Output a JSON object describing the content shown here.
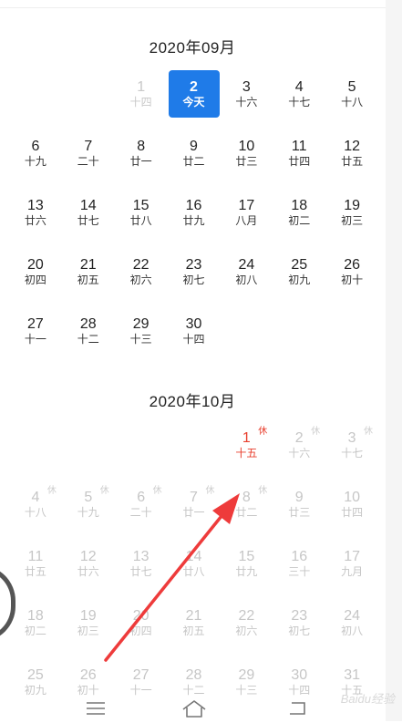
{
  "months": [
    {
      "title": "2020年09月",
      "cells": [
        {
          "blank": true
        },
        {
          "blank": true
        },
        {
          "num": "1",
          "lunar": "十四",
          "state": "prev"
        },
        {
          "num": "2",
          "lunar": "今天",
          "state": "today"
        },
        {
          "num": "3",
          "lunar": "十六"
        },
        {
          "num": "4",
          "lunar": "十七"
        },
        {
          "num": "5",
          "lunar": "十八"
        },
        {
          "num": "6",
          "lunar": "十九"
        },
        {
          "num": "7",
          "lunar": "二十"
        },
        {
          "num": "8",
          "lunar": "廿一"
        },
        {
          "num": "9",
          "lunar": "廿二"
        },
        {
          "num": "10",
          "lunar": "廿三"
        },
        {
          "num": "11",
          "lunar": "廿四"
        },
        {
          "num": "12",
          "lunar": "廿五"
        },
        {
          "num": "13",
          "lunar": "廿六"
        },
        {
          "num": "14",
          "lunar": "廿七"
        },
        {
          "num": "15",
          "lunar": "廿八"
        },
        {
          "num": "16",
          "lunar": "廿九"
        },
        {
          "num": "17",
          "lunar": "八月"
        },
        {
          "num": "18",
          "lunar": "初二"
        },
        {
          "num": "19",
          "lunar": "初三"
        },
        {
          "num": "20",
          "lunar": "初四"
        },
        {
          "num": "21",
          "lunar": "初五"
        },
        {
          "num": "22",
          "lunar": "初六"
        },
        {
          "num": "23",
          "lunar": "初七"
        },
        {
          "num": "24",
          "lunar": "初八"
        },
        {
          "num": "25",
          "lunar": "初九"
        },
        {
          "num": "26",
          "lunar": "初十"
        },
        {
          "num": "27",
          "lunar": "十一"
        },
        {
          "num": "28",
          "lunar": "十二"
        },
        {
          "num": "29",
          "lunar": "十三"
        },
        {
          "num": "30",
          "lunar": "十四"
        }
      ]
    },
    {
      "title": "2020年10月",
      "cells": [
        {
          "blank": true
        },
        {
          "blank": true
        },
        {
          "blank": true
        },
        {
          "blank": true
        },
        {
          "num": "1",
          "lunar": "十五",
          "state": "red",
          "badge": "休"
        },
        {
          "num": "2",
          "lunar": "十六",
          "state": "faded",
          "badge": "休"
        },
        {
          "num": "3",
          "lunar": "十七",
          "state": "faded",
          "badge": "休"
        },
        {
          "num": "4",
          "lunar": "十八",
          "state": "faded",
          "badge": "休"
        },
        {
          "num": "5",
          "lunar": "十九",
          "state": "faded",
          "badge": "休"
        },
        {
          "num": "6",
          "lunar": "二十",
          "state": "faded",
          "badge": "休"
        },
        {
          "num": "7",
          "lunar": "廿一",
          "state": "faded",
          "badge": "休"
        },
        {
          "num": "8",
          "lunar": "廿二",
          "state": "faded",
          "badge": "休"
        },
        {
          "num": "9",
          "lunar": "廿三",
          "state": "faded"
        },
        {
          "num": "10",
          "lunar": "廿四",
          "state": "faded"
        },
        {
          "num": "11",
          "lunar": "廿五",
          "state": "faded"
        },
        {
          "num": "12",
          "lunar": "廿六",
          "state": "faded"
        },
        {
          "num": "13",
          "lunar": "廿七",
          "state": "faded"
        },
        {
          "num": "14",
          "lunar": "廿八",
          "state": "faded"
        },
        {
          "num": "15",
          "lunar": "廿九",
          "state": "faded"
        },
        {
          "num": "16",
          "lunar": "三十",
          "state": "faded"
        },
        {
          "num": "17",
          "lunar": "九月",
          "state": "faded"
        },
        {
          "num": "18",
          "lunar": "初二",
          "state": "faded"
        },
        {
          "num": "19",
          "lunar": "初三",
          "state": "faded"
        },
        {
          "num": "20",
          "lunar": "初四",
          "state": "faded"
        },
        {
          "num": "21",
          "lunar": "初五",
          "state": "faded"
        },
        {
          "num": "22",
          "lunar": "初六",
          "state": "faded"
        },
        {
          "num": "23",
          "lunar": "初七",
          "state": "faded"
        },
        {
          "num": "24",
          "lunar": "初八",
          "state": "faded"
        },
        {
          "num": "25",
          "lunar": "初九",
          "state": "faded"
        },
        {
          "num": "26",
          "lunar": "初十",
          "state": "faded"
        },
        {
          "num": "27",
          "lunar": "十一",
          "state": "faded"
        },
        {
          "num": "28",
          "lunar": "十二",
          "state": "faded"
        },
        {
          "num": "29",
          "lunar": "十三",
          "state": "faded"
        },
        {
          "num": "30",
          "lunar": "十四",
          "state": "faded"
        },
        {
          "num": "31",
          "lunar": "十五",
          "state": "faded"
        }
      ]
    }
  ],
  "watermark": "Baidu经验",
  "colors": {
    "today_bg": "#1f7be8",
    "holiday_red": "#e8402f",
    "annotation_arrow": "#ee3b3b"
  },
  "nav_icons": [
    "menu-icon",
    "home-icon",
    "back-icon"
  ]
}
